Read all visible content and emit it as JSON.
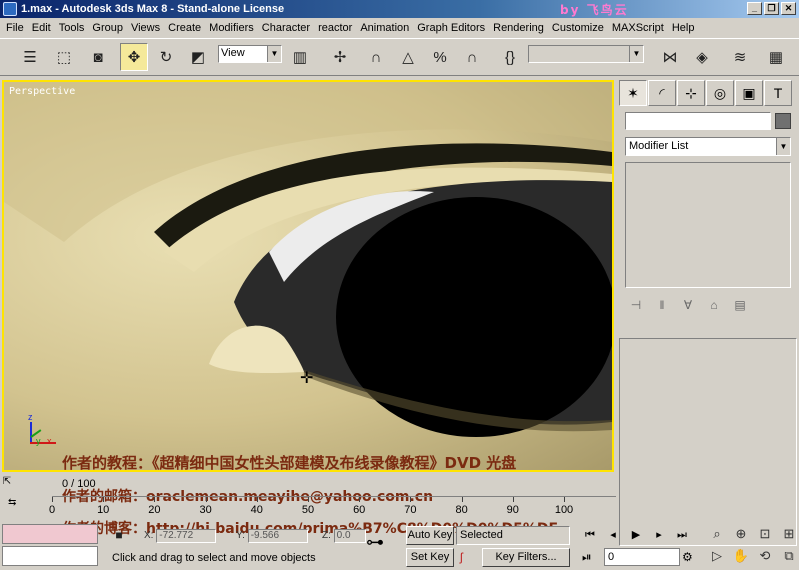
{
  "title": "1.max - Autodesk 3ds Max 8  - Stand-alone License",
  "watermark": "by 飞鸟云",
  "window_buttons": [
    "_",
    "❐",
    "✕"
  ],
  "menu": [
    "File",
    "Edit",
    "Tools",
    "Group",
    "Views",
    "Create",
    "Modifiers",
    "Character",
    "reactor",
    "Animation",
    "Graph Editors",
    "Rendering",
    "Customize",
    "MAXScript",
    "Help"
  ],
  "toolbar": {
    "reference_coord": "View",
    "named_selection": ""
  },
  "viewport": {
    "label": "Perspective",
    "axis_x": "x",
    "axis_y": "y",
    "axis_z": "z"
  },
  "overlay": {
    "line1": "作者的教程：《超精细中国女性头部建模及布线录像教程》DVD 光盘",
    "line2": "作者的邮箱：oraclemean.meayihe@yahoo.com.cn",
    "line3": "作者的博客：http://hi.baidu.com/prima%B7%C8%D0%D0%D5%DF"
  },
  "command_panel": {
    "name": "",
    "modifier_list": "Modifier List"
  },
  "timeline": {
    "position": "0 / 100",
    "ruler": [
      "0",
      "10",
      "20",
      "30",
      "40",
      "50",
      "60",
      "70",
      "80",
      "90",
      "100"
    ]
  },
  "status": {
    "x_label": "X:",
    "x_value": "-72.772",
    "y_label": "Y:",
    "y_value": "-9.566",
    "z_label": "Z:",
    "z_value": "0.0",
    "prompt": "Click and drag to select and move objects",
    "auto_key": "Auto Key",
    "set_key": "Set Key",
    "selected": "Selected",
    "key_filters": "Key Filters...",
    "current_frame": "0"
  }
}
